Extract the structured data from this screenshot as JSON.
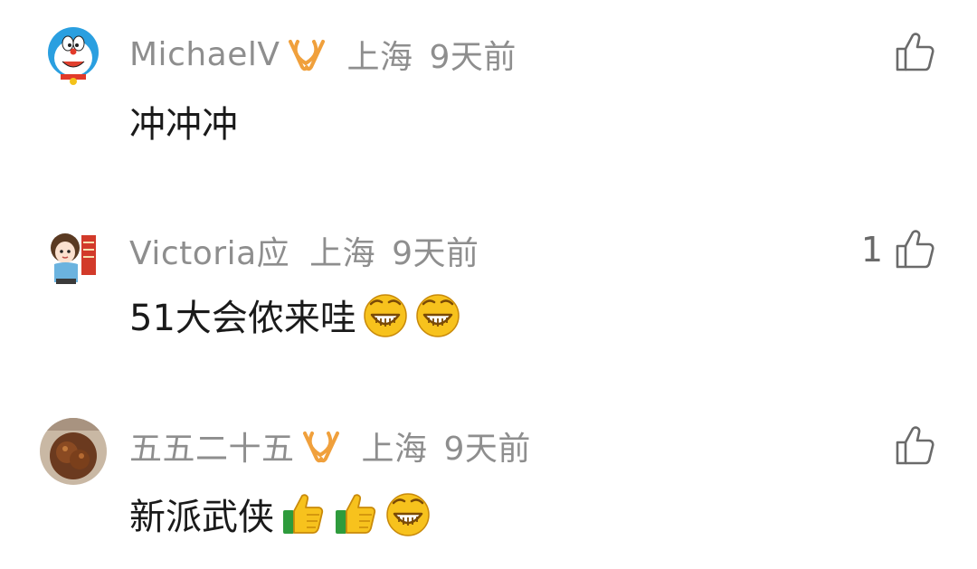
{
  "comments": [
    {
      "username": "MichaelV",
      "location": "上海",
      "time": "9天前",
      "text": "冲冲冲",
      "like_count": "",
      "avatar_icon": "doraemon-avatar-icon",
      "badge_icon": "vip-badge-icon"
    },
    {
      "username": "Victoria应",
      "location": "上海",
      "time": "9天前",
      "text": "51大会侬来哇",
      "like_count": "1",
      "avatar_icon": "cartoon-girl-avatar-icon",
      "emojis": [
        "grin-emoji-icon",
        "grin-emoji-icon"
      ]
    },
    {
      "username": "五五二十五",
      "location": "上海",
      "time": "9天前",
      "text": "新派武侠",
      "like_count": "",
      "avatar_icon": "food-photo-avatar-icon",
      "badge_icon": "vip-badge-icon",
      "emojis": [
        "thumbs-up-emoji-icon",
        "thumbs-up-emoji-icon",
        "grin-emoji-icon"
      ]
    }
  ],
  "colors": {
    "meta_text": "#8e8e8e",
    "body_text": "#1a1a1a",
    "badge": "#f0a03c"
  }
}
